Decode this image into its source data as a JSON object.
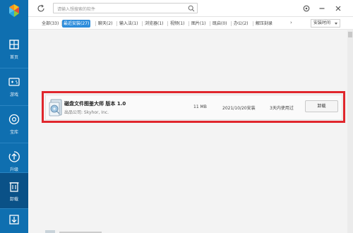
{
  "sidebar": {
    "items": [
      {
        "label": "首页",
        "icon": "home-icon"
      },
      {
        "label": "游戏",
        "icon": "gamepad-icon"
      },
      {
        "label": "宝库",
        "icon": "vault-icon"
      },
      {
        "label": "升级",
        "icon": "upgrade-icon"
      },
      {
        "label": "卸载",
        "icon": "trash-icon"
      },
      {
        "label": "",
        "icon": "download-icon"
      }
    ],
    "active": "卸载",
    "colors": {
      "bg": "#0f6fb0",
      "active_bg": "#0a5187"
    }
  },
  "topbar": {
    "search_placeholder": "请输入想搜索的软件",
    "icons": [
      "refresh-icon",
      "search-icon",
      "settings-icon",
      "minimize-icon",
      "close-icon"
    ]
  },
  "tabs": [
    "全部(33)",
    "最近安装(27)",
    "聊天(2)",
    "输入法(1)",
    "浏览器(1)",
    "视频(1)",
    "图片(1)",
    "既启(0)",
    "办公(2)",
    "解压刻录"
  ],
  "active_tab": "最近安装(27)",
  "sort": {
    "selected": "安装时间"
  },
  "app": {
    "name": "磁盘文件图鉴大师 版本 1.0",
    "publisher": "出品公司: Skyhor, Inc.",
    "size": "11 MB",
    "date": "2021/10/20安装",
    "usage": "3天内使用过",
    "uninstall_label": "卸载"
  },
  "colors": {
    "accent": "#2e8ddb",
    "highlight_border": "#e0262c"
  }
}
